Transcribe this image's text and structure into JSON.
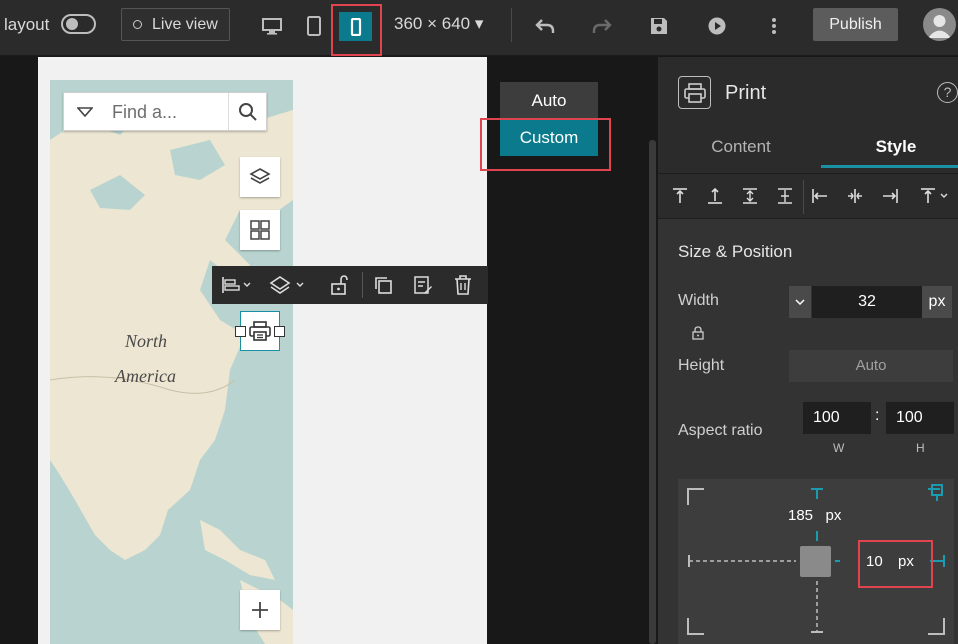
{
  "topbar": {
    "layout_label": "layout",
    "live_view_label": "Live view",
    "screen_size": "360 × 640",
    "publish_label": "Publish"
  },
  "map": {
    "search_placeholder": "Find a...",
    "label_north": "North",
    "label_america": "America"
  },
  "size_mode_menu": {
    "options": [
      "Auto",
      "Custom"
    ],
    "selected": "Custom"
  },
  "panel": {
    "title": "Print",
    "help": "?",
    "tabs": [
      "Content",
      "Style"
    ],
    "active_tab": "Style",
    "section_title": "Size & Position",
    "width_label": "Width",
    "width_value": "32",
    "width_unit": "px",
    "height_label": "Height",
    "height_value": "Auto",
    "aspect_label": "Aspect ratio",
    "aspect_w": "100",
    "aspect_h": "100",
    "aspect_w_sub": "W",
    "aspect_h_sub": "H",
    "top_offset": "185",
    "top_offset_unit": "px",
    "right_offset": "10",
    "right_offset_unit": "px"
  },
  "colors": {
    "accent": "#0a7a8c",
    "highlight": "#e0454f"
  }
}
